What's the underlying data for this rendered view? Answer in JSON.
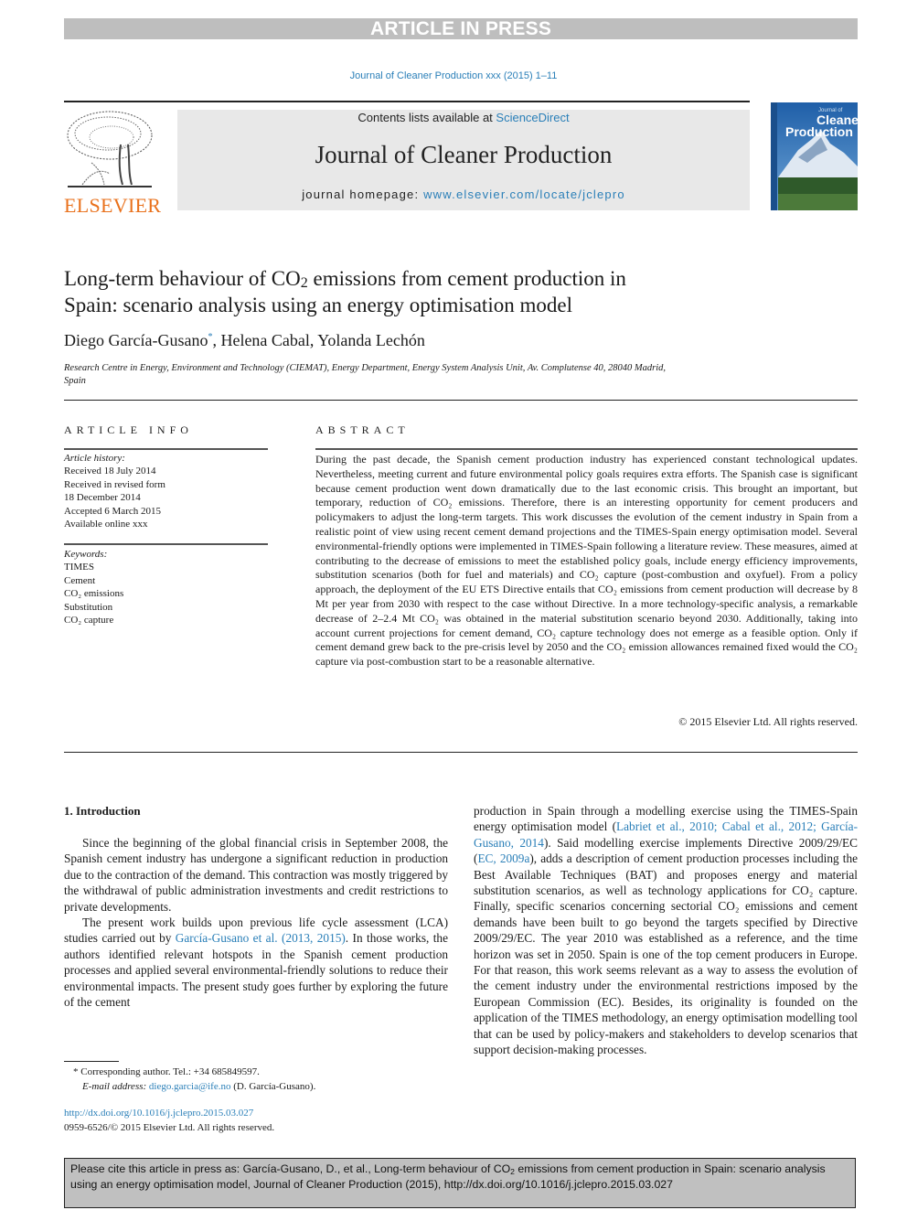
{
  "banner": "ARTICLE IN PRESS",
  "journal_ref": "Journal of Cleaner Production xxx (2015) 1–11",
  "masthead": {
    "contents_prefix": "Contents lists available at ",
    "contents_link": "ScienceDirect",
    "journal_name": "Journal of Cleaner Production",
    "homepage_prefix": "journal homepage: ",
    "homepage_link": "www.elsevier.com/locate/jclepro",
    "publisher_logo": "ELSEVIER",
    "cover": {
      "line1": "Journal of",
      "line2": "Cleaner",
      "line3": "Production"
    }
  },
  "article": {
    "title_part1": "Long-term behaviour of CO",
    "title_sub": "2",
    "title_part2": " emissions from cement production in",
    "title_line2": "Spain: scenario analysis using an energy optimisation model",
    "author1": "Diego García-Gusano",
    "author1_mark": "*",
    "authors_rest": ", Helena Cabal, Yolanda Lechón",
    "affiliation_line1": "Research Centre in Energy, Environment and Technology (CIEMAT), Energy Department, Energy System Analysis Unit, Av. Complutense 40, 28040 Madrid,",
    "affiliation_line2": "Spain"
  },
  "article_info": {
    "heading": "ARTICLE INFO",
    "history_label": "Article history:",
    "history": [
      "Received 18 July 2014",
      "Received in revised form",
      "18 December 2014",
      "Accepted 6 March 2015",
      "Available online xxx"
    ],
    "keywords_label": "Keywords:",
    "keywords": [
      "TIMES",
      "Cement",
      "CO₂ emissions",
      "Substitution",
      "CO₂ capture"
    ]
  },
  "abstract": {
    "heading": "ABSTRACT",
    "text": "During the past decade, the Spanish cement production industry has experienced constant technological updates. Nevertheless, meeting current and future environmental policy goals requires extra efforts. The Spanish case is significant because cement production went down dramatically due to the last economic crisis. This brought an important, but temporary, reduction of CO₂ emissions. Therefore, there is an interesting opportunity for cement producers and policymakers to adjust the long-term targets. This work discusses the evolution of the cement industry in Spain from a realistic point of view using recent cement demand projections and the TIMES-Spain energy optimisation model. Several environmental-friendly options were implemented in TIMES-Spain following a literature review. These measures, aimed at contributing to the decrease of emissions to meet the established policy goals, include energy efficiency improvements, substitution scenarios (both for fuel and materials) and CO₂ capture (post-combustion and oxyfuel). From a policy approach, the deployment of the EU ETS Directive entails that CO₂ emissions from cement production will decrease by 8 Mt per year from 2030 with respect to the case without Directive. In a more technology-specific analysis, a remarkable decrease of 2–2.4 Mt CO₂ was obtained in the material substitution scenario beyond 2030. Additionally, taking into account current projections for cement demand, CO₂ capture technology does not emerge as a feasible option. Only if cement demand grew back to the pre-crisis level by 2050 and the CO₂ emission allowances remained fixed would the CO₂ capture via post-combustion start to be a reasonable alternative.",
    "copyright": "© 2015 Elsevier Ltd. All rights reserved."
  },
  "introduction": {
    "heading": "1.  Introduction",
    "p1": "Since the beginning of the global financial crisis in September 2008, the Spanish cement industry has undergone a significant reduction in production due to the contraction of the demand. This contraction was mostly triggered by the withdrawal of public administration investments and credit restrictions to private developments.",
    "p2_a": "The present work builds upon previous life cycle assessment (LCA) studies carried out by ",
    "p2_link": "García-Gusano et al. (2013, 2015)",
    "p2_b": ". In those works, the authors identified relevant hotspots in the Spanish cement production processes and applied several environmental-friendly solutions to reduce their environmental impacts. The present study goes further by exploring the future of the cement",
    "col2_a": "production in Spain through a modelling exercise using the TIMES-Spain energy optimisation model (",
    "col2_link1": "Labriet et al., 2010; Cabal et al., 2012; García-Gusano, 2014",
    "col2_b": "). Said modelling exercise implements Directive 2009/29/EC (",
    "col2_link2": "EC, 2009a",
    "col2_c": "), adds a description of cement production processes including the Best Available Techniques (BAT) and proposes energy and material substitution scenarios, as well as technology applications for CO₂ capture. Finally, specific scenarios concerning sectorial CO₂ emissions and cement demands have been built to go beyond the targets specified by Directive 2009/29/EC. The year 2010 was established as a reference, and the time horizon was set in 2050. Spain is one of the top cement producers in Europe. For that reason, this work seems relevant as a way to assess the evolution of the cement industry under the environmental restrictions imposed by the European Commission (EC). Besides, its originality is founded on the application of the TIMES methodology, an energy optimisation modelling tool that can be used by policy-makers and stakeholders to develop scenarios that support decision-making processes."
  },
  "footnote": {
    "corresponding": "* Corresponding author. Tel.: +34 685849597.",
    "email_label": "E-mail address: ",
    "email": "diego.garcia@ife.no",
    "email_suffix": " (D. García-Gusano).",
    "doi": "http://dx.doi.org/10.1016/j.jclepro.2015.03.027",
    "issn": "0959-6526/© 2015 Elsevier Ltd. All rights reserved."
  },
  "citation_box": {
    "text_a": "Please cite this article in press as: García-Gusano, D., et al., Long-term behaviour of CO",
    "text_sub": "2",
    "text_b": " emissions from cement production in Spain: scenario analysis using an energy optimisation model, Journal of Cleaner Production (2015), http://dx.doi.org/10.1016/j.jclepro.2015.03.027"
  }
}
